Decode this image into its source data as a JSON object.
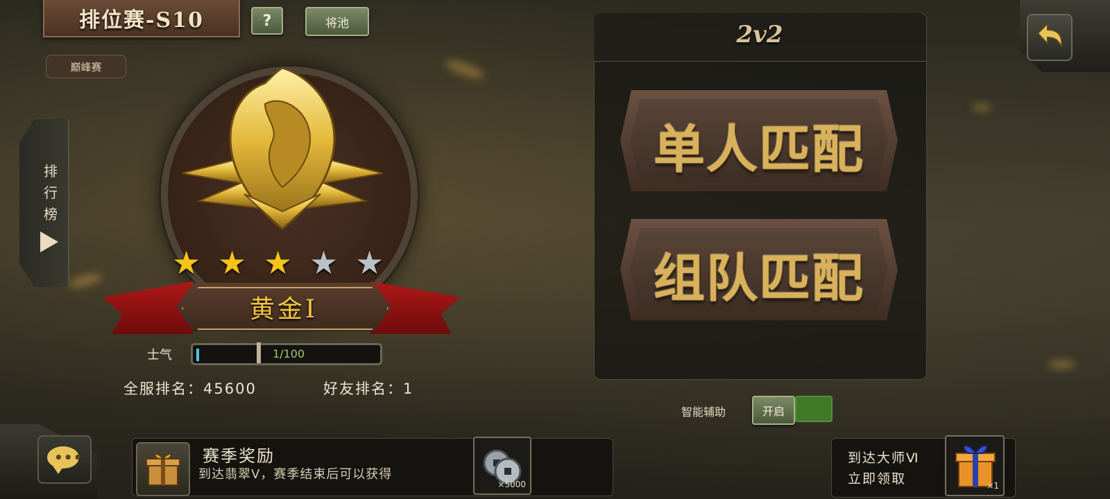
{
  "header": {
    "season_title": "排位赛-S10",
    "help_label": "?",
    "pool_label": "将池",
    "peak_label": "巅峰赛"
  },
  "side": {
    "leaderboard_label": "排行榜"
  },
  "rank": {
    "tier": "黄金Ⅰ",
    "stars_filled": 3,
    "stars_total": 5,
    "morale_label": "士气",
    "morale_text": "1/100",
    "morale_fraction": 0.01,
    "server_rank": "全服排名：45600",
    "friend_rank": "好友排名：1"
  },
  "mode": {
    "title": "2v2",
    "solo_label": "单人匹配",
    "team_label": "组队匹配"
  },
  "assist": {
    "label": "智能辅助",
    "toggle_label": "开启",
    "toggle_color": "#3f7a26"
  },
  "season_reward": {
    "title": "赛季奖励",
    "desc": "到达翡翠Ⅴ，赛季结束后可以获得",
    "item_qty": "×5000",
    "item_icon": "coin-icon"
  },
  "master_reward": {
    "line1": "到达大师Ⅵ",
    "line2": "立即领取",
    "item_qty": "×1",
    "item_icon": "gift-box-icon"
  },
  "icons": {
    "chat": "chat-bubble-icon",
    "back": "back-arrow-icon",
    "gift": "gift-icon"
  },
  "colors": {
    "gold": "#f6c21c",
    "silver": "#b9c0c8",
    "ribbon": "#b01818",
    "toggle_on": "#3f7a26"
  }
}
